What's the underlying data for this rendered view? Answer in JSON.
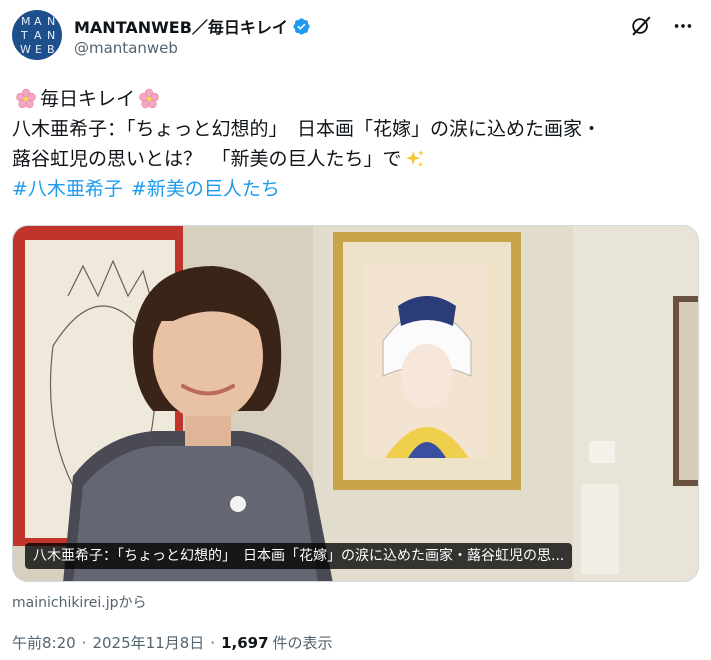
{
  "header": {
    "avatar_letters": [
      "M",
      "A",
      "N",
      "T",
      "A",
      "N",
      "W",
      "E",
      "B"
    ],
    "display_name": "MANTANWEB／毎日キレイ",
    "handle": "@mantanweb",
    "verified_color": "#1d9bf0"
  },
  "tweet": {
    "line1_text": "毎日キレイ",
    "line2": "八木亜希子：「ちょっと幻想的」　日本画「花嫁」の涙に込めた画家・",
    "line3": "蕗谷虹児の思いとは？　「新美の巨人たち」で",
    "hashtags": [
      "#八木亜希子",
      "#新美の巨人たち"
    ]
  },
  "media": {
    "caption": "八木亜希子：「ちょっと幻想的」　日本画「花嫁」の涙に込めた画家・蕗谷虹児の思..."
  },
  "source_link": "mainichikirei.jpから",
  "meta": {
    "time": "午前8:20",
    "date": "2025年11月8日",
    "views_count": "1,697",
    "views_label": "件の表示"
  },
  "colors": {
    "accent": "#1d9bf0",
    "text_primary": "#0f1419",
    "text_secondary": "#536471"
  },
  "icons": [
    "grok-icon",
    "more-icon",
    "verified-badge-icon",
    "cherry-blossom-icon",
    "sparkles-icon"
  ]
}
